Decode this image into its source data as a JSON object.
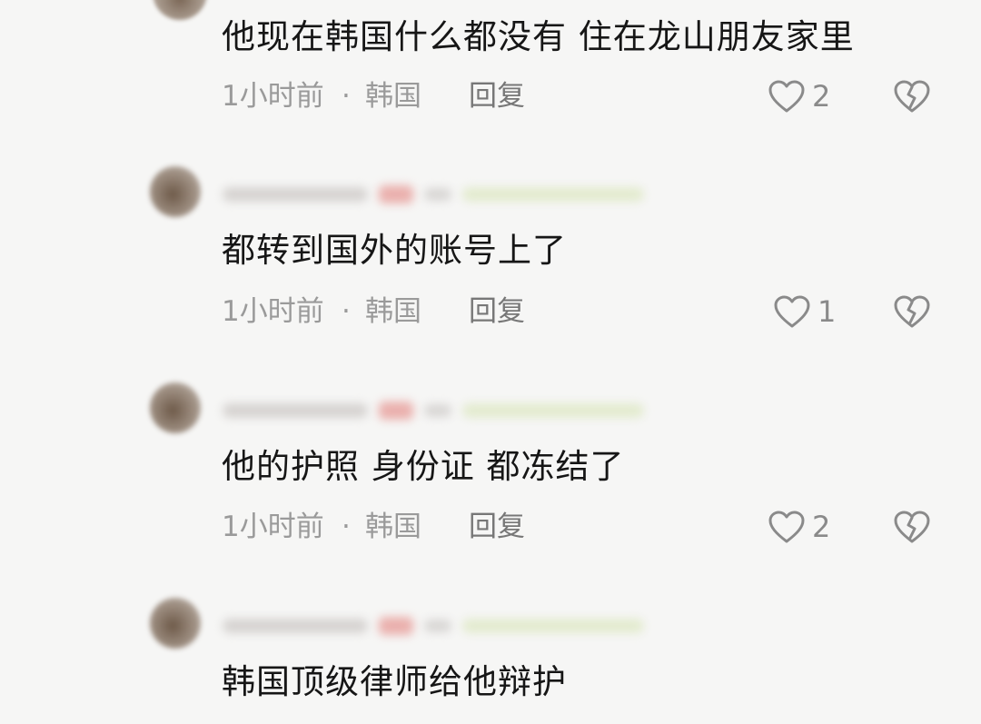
{
  "comments": [
    {
      "text": "他现在韩国什么都没有 住在龙山朋友家里",
      "time": "1小时前",
      "dot": "·",
      "location": "韩国",
      "reply": "回复",
      "likes": "2"
    },
    {
      "text": "都转到国外的账号上了",
      "time": "1小时前",
      "dot": "·",
      "location": "韩国",
      "reply": "回复",
      "likes": "1"
    },
    {
      "text": "他的护照 身份证 都冻结了",
      "time": "1小时前",
      "dot": "·",
      "location": "韩国",
      "reply": "回复",
      "likes": "2"
    },
    {
      "text": "韩国顶级律师给他辩护"
    }
  ],
  "icons": {
    "like": "heart-outline-icon",
    "dislike": "broken-heart-icon"
  },
  "colors": {
    "background": "#f6f6f5",
    "text": "#161616",
    "meta": "#9a9a9a",
    "icon": "#8a8a8a"
  }
}
